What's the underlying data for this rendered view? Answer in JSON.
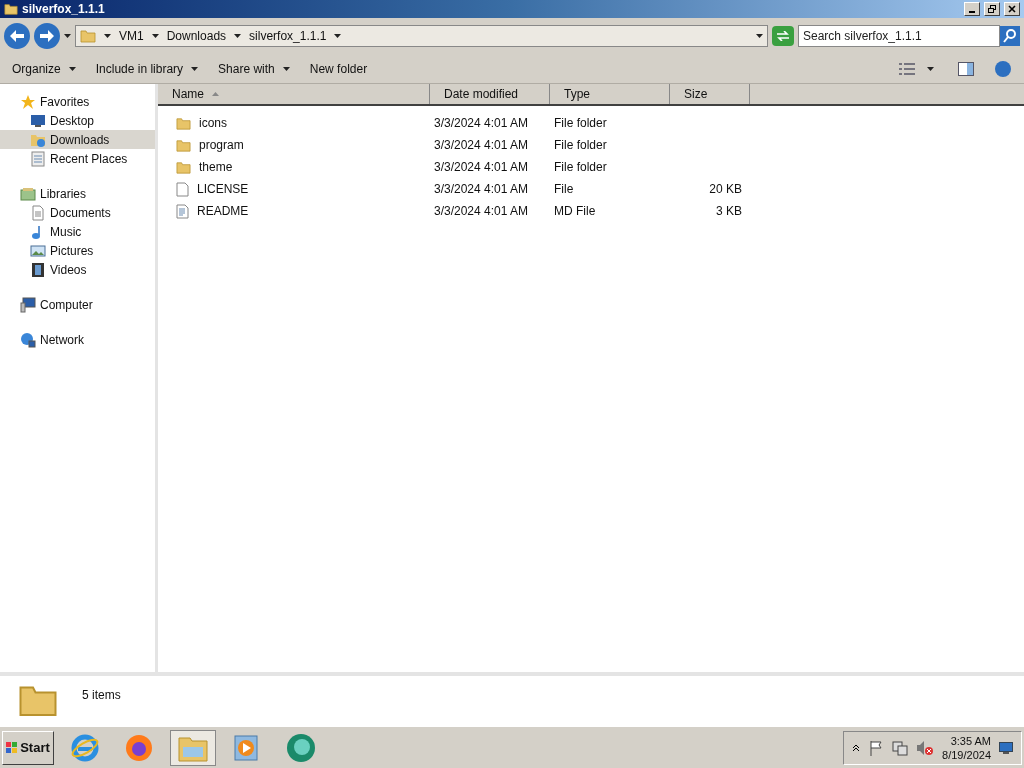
{
  "window": {
    "title": "silverfox_1.1.1"
  },
  "address": {
    "crumbs": [
      "VM1",
      "Downloads",
      "silverfox_1.1.1"
    ]
  },
  "search": {
    "placeholder": "Search silverfox_1.1.1"
  },
  "toolbar": [
    {
      "label": "Organize",
      "has_menu": true
    },
    {
      "label": "Include in library",
      "has_menu": true
    },
    {
      "label": "Share with",
      "has_menu": true
    },
    {
      "label": "New folder",
      "has_menu": false
    }
  ],
  "nav": [
    {
      "label": "Favorites",
      "kind": "star",
      "children": [
        {
          "label": "Desktop",
          "kind": "desktop",
          "selected": false
        },
        {
          "label": "Downloads",
          "kind": "downloads",
          "selected": true
        },
        {
          "label": "Recent Places",
          "kind": "recent",
          "selected": false
        }
      ]
    },
    {
      "label": "Libraries",
      "kind": "library",
      "children": [
        {
          "label": "Documents",
          "kind": "document",
          "selected": false
        },
        {
          "label": "Music",
          "kind": "music",
          "selected": false
        },
        {
          "label": "Pictures",
          "kind": "picture",
          "selected": false
        },
        {
          "label": "Videos",
          "kind": "video",
          "selected": false
        }
      ]
    },
    {
      "label": "Computer",
      "kind": "computer"
    },
    {
      "label": "Network",
      "kind": "network"
    }
  ],
  "columns": [
    {
      "label": "Name",
      "sorted": true
    },
    {
      "label": "Date modified",
      "sorted": false
    },
    {
      "label": "Type",
      "sorted": false
    },
    {
      "label": "Size",
      "sorted": false
    }
  ],
  "rows": [
    {
      "name": "icons",
      "kind": "folder",
      "date": "3/3/2024 4:01 AM",
      "type": "File folder"
    },
    {
      "name": "program",
      "kind": "folder",
      "date": "3/3/2024 4:01 AM",
      "type": "File folder"
    },
    {
      "name": "theme",
      "kind": "folder",
      "date": "3/3/2024 4:01 AM",
      "type": "File folder"
    },
    {
      "name": "LICENSE",
      "kind": "file",
      "date": "3/3/2024 4:01 AM",
      "type": "File",
      "size": "20 KB"
    },
    {
      "name": "README",
      "kind": "text",
      "date": "3/3/2024 4:01 AM",
      "type": "MD File",
      "size": "3 KB"
    }
  ],
  "details": {
    "count": "5 items"
  },
  "taskbar": {
    "start": "Start",
    "apps": [
      {
        "kind": "browser",
        "selected": false
      },
      {
        "kind": "firefox",
        "selected": false
      },
      {
        "kind": "explorer",
        "selected": true
      },
      {
        "kind": "media",
        "selected": false
      },
      {
        "kind": "chat",
        "selected": false
      }
    ],
    "time": "3:35 AM",
    "date": "8/19/2024"
  }
}
